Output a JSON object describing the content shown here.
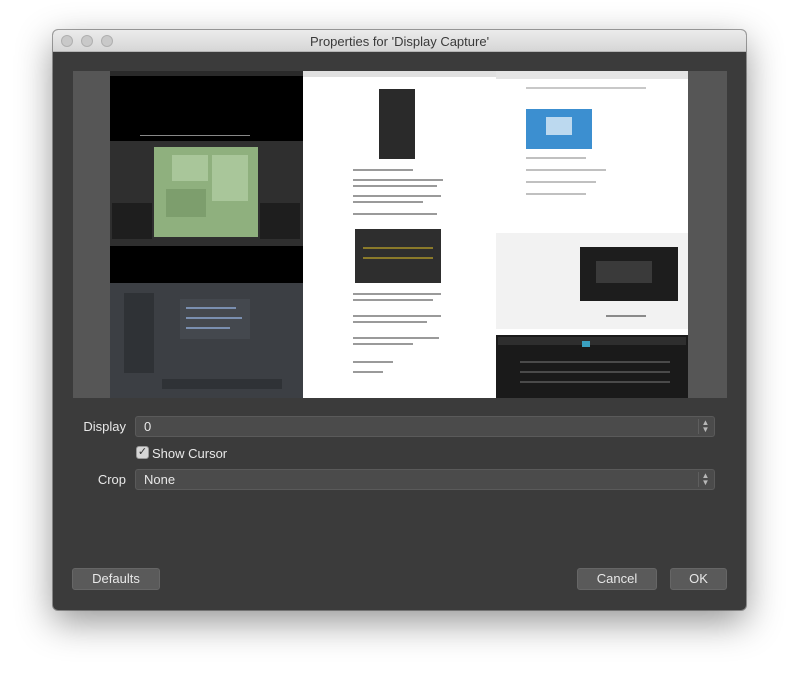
{
  "window": {
    "title": "Properties for 'Display Capture'"
  },
  "form": {
    "display_label": "Display",
    "display_value": "0",
    "show_cursor_label": "Show Cursor",
    "show_cursor_checked": true,
    "crop_label": "Crop",
    "crop_value": "None"
  },
  "buttons": {
    "defaults": "Defaults",
    "cancel": "Cancel",
    "ok": "OK"
  },
  "icons": {
    "checkmark": "✓",
    "spin_up": "▲",
    "spin_down": "▼"
  },
  "colors": {
    "window_bg": "#3b3b3b",
    "field_bg": "#4b4b4b",
    "button_bg": "#5a5a5a",
    "text": "#e8e8e8"
  }
}
